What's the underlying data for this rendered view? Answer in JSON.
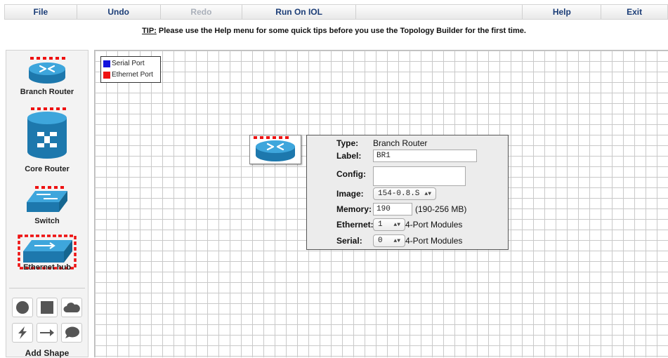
{
  "menu": {
    "items": [
      {
        "label": "File",
        "enabled": true
      },
      {
        "label": "Undo",
        "enabled": true
      },
      {
        "label": "Redo",
        "enabled": false
      },
      {
        "label": "Run On IOL",
        "enabled": true
      },
      {
        "label": "",
        "enabled": false
      },
      {
        "label": "Help",
        "enabled": true
      },
      {
        "label": "Exit",
        "enabled": true
      }
    ]
  },
  "tip": {
    "prefix": "TIP:",
    "text": " Please use the Help menu for some quick tips before you use the Topology Builder for the first time."
  },
  "palette": {
    "devices": [
      {
        "label": "Branch Router",
        "icon": "branch-router-icon"
      },
      {
        "label": "Core Router",
        "icon": "core-router-icon"
      },
      {
        "label": "Switch",
        "icon": "switch-icon"
      },
      {
        "label": "Ethernet hub",
        "icon": "ethernet-hub-icon"
      }
    ],
    "shapes_label": "Add Shape",
    "shapes": [
      "circle-icon",
      "square-icon",
      "cloud-icon",
      "lightning-icon",
      "arrow-icon",
      "speech-bubble-icon"
    ]
  },
  "legend": {
    "items": [
      {
        "label": "Serial Port",
        "color": "#1111dd"
      },
      {
        "label": "Ethernet Port",
        "color": "#ee1111"
      }
    ]
  },
  "properties": {
    "type_label": "Type:",
    "type_value": "Branch Router",
    "label_label": "Label:",
    "label_value": "BR1",
    "config_label": "Config:",
    "config_value": "",
    "image_label": "Image:",
    "image_value": "154-0.8.S",
    "memory_label": "Memory:",
    "memory_value": "190",
    "memory_range": "(190-256 MB)",
    "ethernet_label": "Ethernet:",
    "ethernet_value": "1",
    "ethernet_suffix": "4-Port Modules",
    "serial_label": "Serial:",
    "serial_value": "0",
    "serial_suffix": "4-Port Modules"
  },
  "colors": {
    "device_blue": "#2a8fc7",
    "menu_text": "#1b3d77"
  }
}
